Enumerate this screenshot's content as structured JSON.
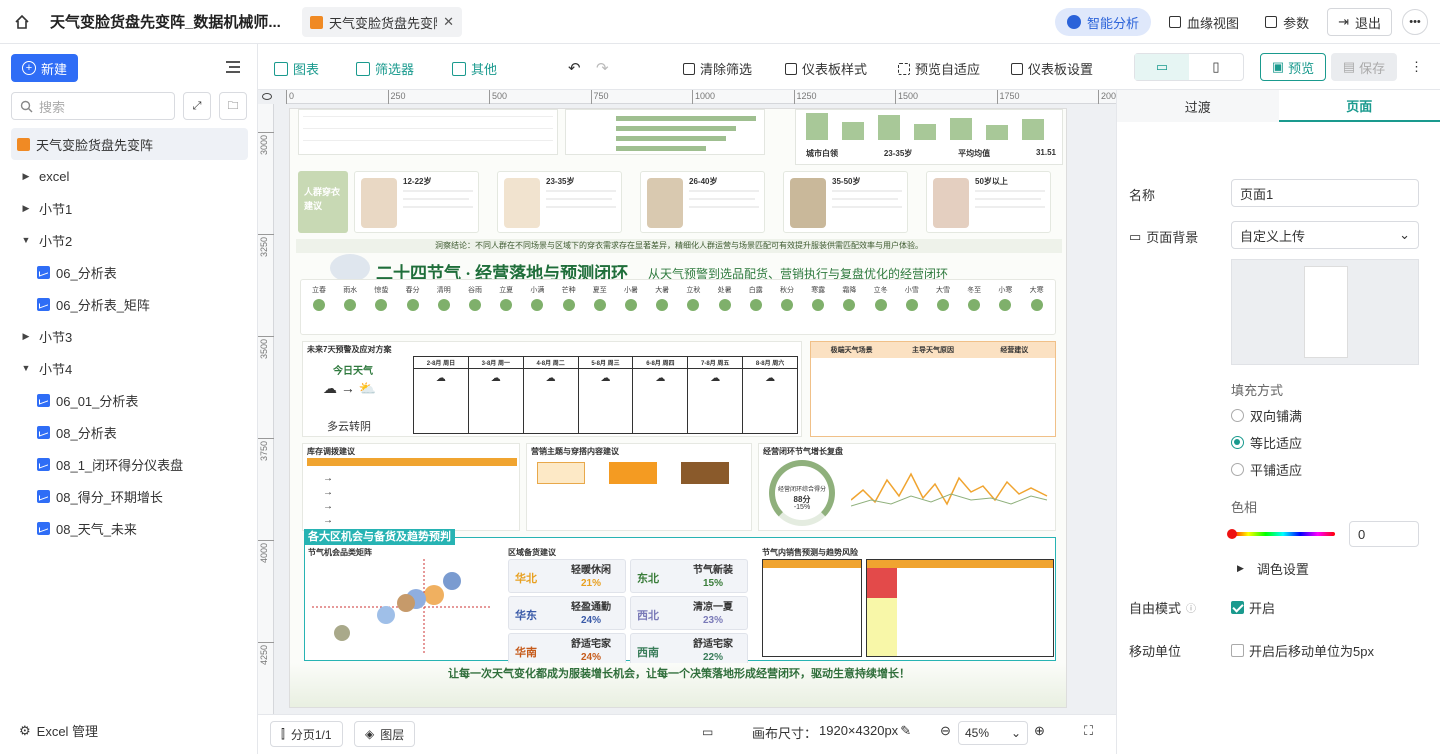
{
  "topbar": {
    "title": "天气变脸货盘先变阵_数据机械师...",
    "tab_label": "天气变脸货盘先变阵",
    "ai_label": "智能分析",
    "lineage_label": "血缘视图",
    "params_label": "参数",
    "exit_label": "退出"
  },
  "sidebar": {
    "new_label": "新建",
    "search_placeholder": "搜索",
    "tree": [
      {
        "label": "天气变脸货盘先变阵",
        "type": "dashboard",
        "level": 0,
        "selected": true
      },
      {
        "label": "excel",
        "type": "folder",
        "level": 0,
        "expanded": false
      },
      {
        "label": "小节1",
        "type": "folder",
        "level": 0,
        "expanded": false
      },
      {
        "label": "小节2",
        "type": "folder",
        "level": 0,
        "expanded": true
      },
      {
        "label": "06_分析表",
        "type": "report",
        "level": 1
      },
      {
        "label": "06_分析表_矩阵",
        "type": "report",
        "level": 1
      },
      {
        "label": "小节3",
        "type": "folder",
        "level": 0,
        "expanded": false
      },
      {
        "label": "小节4",
        "type": "folder",
        "level": 0,
        "expanded": true
      },
      {
        "label": "06_01_分析表",
        "type": "report",
        "level": 1
      },
      {
        "label": "08_分析表",
        "type": "report",
        "level": 1
      },
      {
        "label": "08_1_闭环得分仪表盘",
        "type": "report",
        "level": 1
      },
      {
        "label": "08_得分_环期增长",
        "type": "report",
        "level": 1
      },
      {
        "label": "08_天气_未来",
        "type": "report",
        "level": 1
      }
    ],
    "excel_manage_label": "Excel 管理"
  },
  "toolbar": {
    "chart_label": "图表",
    "filter_label": "筛选器",
    "other_label": "其他",
    "clear_filter_label": "清除筛选",
    "dashboard_style_label": "仪表板样式",
    "preview_fit_label": "预览自适应",
    "dashboard_settings_label": "仪表板设置",
    "preview_label": "预览",
    "save_label": "保存"
  },
  "ruler": {
    "top": [
      "0",
      "250",
      "500",
      "750",
      "1000",
      "1250",
      "1500",
      "1750",
      "2000"
    ],
    "left": [
      "3000",
      "3250",
      "3500",
      "3750",
      "4000",
      "4250"
    ]
  },
  "canvas": {
    "conclusion": "洞察结论：不同人群在不同场景与区域下的穿衣需求存在显著差异，精细化人群运营与场景匹配可有效提升服装供需匹配效率与用户体验。",
    "persona_title": "人群穿衣建议",
    "personas": [
      "12-22岁",
      "23-35岁",
      "26-40岁",
      "35-50岁",
      "50岁以上"
    ],
    "bars_labels": [
      "城市白领",
      "23-35岁",
      "平均均值",
      "31.51"
    ],
    "section_title": "二十四节气 · 经营落地与预测闭环",
    "section_subtitle": "从天气预警到选品配货、营销执行与复盘优化的经营闭环",
    "solar_terms": [
      "立春",
      "雨水",
      "惊蛰",
      "春分",
      "清明",
      "谷雨",
      "立夏",
      "小满",
      "芒种",
      "夏至",
      "小暑",
      "大暑",
      "立秋",
      "处暑",
      "白露",
      "秋分",
      "寒露",
      "霜降",
      "立冬",
      "小雪",
      "大雪",
      "冬至",
      "小寒",
      "大寒"
    ],
    "forecast_title": "未来7天预警及应对方案",
    "today_label": "今日天气",
    "today_weather": "多云转阴",
    "forecast_days": [
      "2-8月 周日",
      "3-8月 周一",
      "4-8月 周二",
      "5-8月 周三",
      "6-8月 周四",
      "7-8月 周五",
      "8-8月 周六"
    ],
    "extreme_header": [
      "极端天气场景",
      "主导天气原因",
      "经营建议"
    ],
    "inventory_title": "库存调拨建议",
    "marketing_title": "营销主题与穿搭内容建议",
    "loop_title": "经营闭环节气增长复盘",
    "gauge_label": "经营闭环综合得分",
    "gauge_score": "88分",
    "gauge_delta": "-15%",
    "region_banner": "各大区机会与备货及趋势预判",
    "matrix_title": "节气机会品类矩阵",
    "region_title": "区域备货建议",
    "sales_title": "节气内销售预测与趋势风险",
    "regions": [
      {
        "name": "华北",
        "style": "轻暖休闲",
        "pct": "21%"
      },
      {
        "name": "东北",
        "style": "节气新装",
        "pct": "15%"
      },
      {
        "name": "华东",
        "style": "轻盈通勤",
        "pct": "24%"
      },
      {
        "name": "西北",
        "style": "清凉一夏",
        "pct": "23%"
      },
      {
        "name": "华南",
        "style": "舒适宅家",
        "pct": "24%"
      },
      {
        "name": "西南",
        "style": "舒适宅家",
        "pct": "22%"
      }
    ],
    "footer": "让每一次天气变化都成为服装增长机会，让每一个决策落地形成经营闭环，驱动生意持续增长！"
  },
  "bottombar": {
    "pages_label": "分页1/1",
    "layers_label": "图层",
    "canvas_size_label": "画布尺寸：",
    "canvas_size_value": "1920×4320px",
    "zoom_value": "45%"
  },
  "props": {
    "tab_transition": "过渡",
    "tab_page": "页面",
    "name_label": "名称",
    "name_value": "页面1",
    "bg_label": "页面背景",
    "bg_value": "自定义上传",
    "fill_label": "填充方式",
    "fill_options": [
      "双向铺满",
      "等比适应",
      "平铺适应"
    ],
    "fill_selected": 1,
    "hue_label": "色相",
    "hue_value": "0",
    "color_settings_label": "调色设置",
    "free_mode_label": "自由模式",
    "free_mode_value": "开启",
    "move_unit_label": "移动单位",
    "move_unit_option": "开启后移动单位为5px"
  }
}
